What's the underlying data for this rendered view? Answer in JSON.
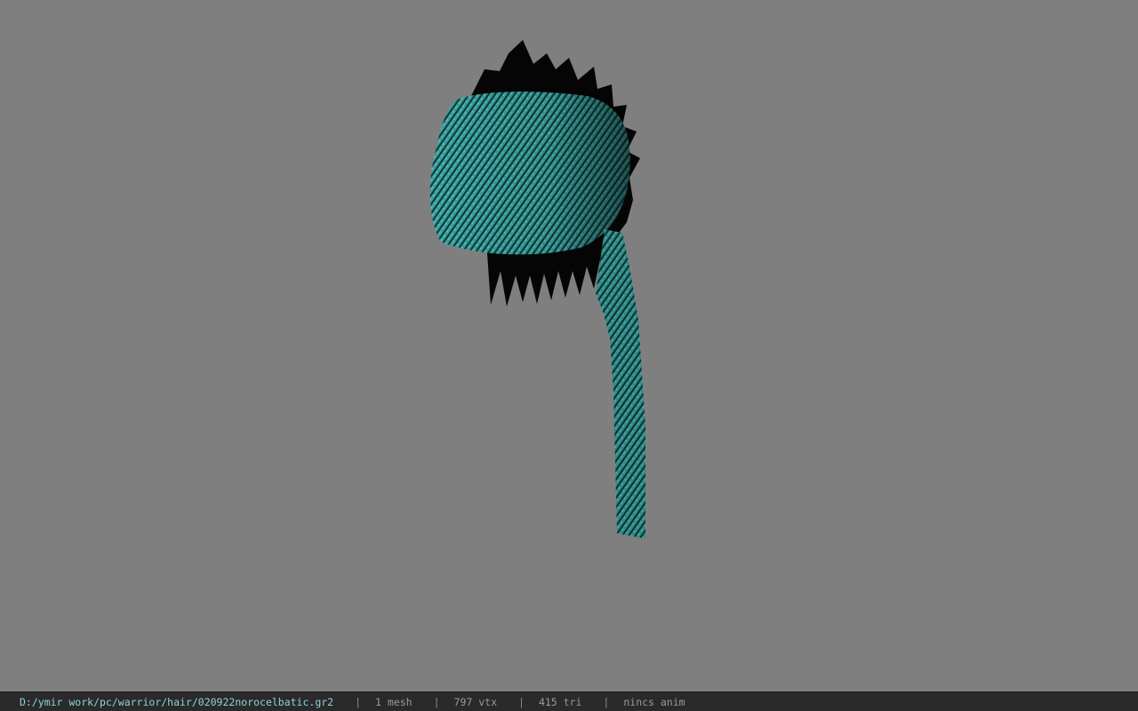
{
  "viewer": {
    "background_color": "#7f7f7f",
    "model_colors": {
      "fabric": "#3aa9a6",
      "hair": "#050505"
    }
  },
  "status_bar": {
    "file_path": "D:/ymir work/pc/warrior/hair/020922norocelbatic.gr2",
    "separator": "|",
    "mesh_count": "1 mesh",
    "vertex_count": "797 vtx",
    "triangle_count": "415 tri",
    "anim_status": "nincs anim"
  }
}
